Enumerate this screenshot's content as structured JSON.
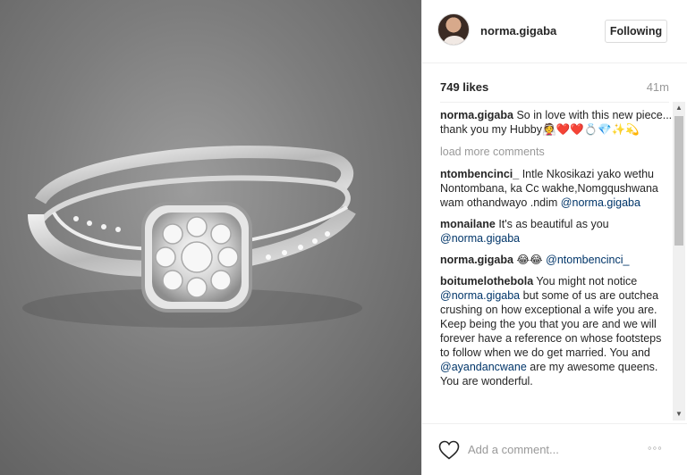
{
  "post": {
    "username": "norma.gigaba",
    "follow_label": "Following",
    "likes": "749 likes",
    "time": "41m",
    "add_comment_placeholder": "Add a comment...",
    "more_icon": "more-options-icon"
  },
  "caption": {
    "user": "norma.gigaba",
    "text": "So in love with this new piece... thank you my Hubby👰❤️❤️💍💎✨💫"
  },
  "load_more": "load more comments",
  "comments": [
    {
      "user": "ntombencinci_",
      "text": "Intle Nkosikazi yako wethu Nontombana, ka Cc wakhe,Nomgqushwana wam othandwayo .ndim ",
      "mention": "@norma.gigaba",
      "text_after": ""
    },
    {
      "user": "monailane",
      "text": "It's as beautiful as you ",
      "mention": "@norma.gigaba",
      "text_after": ""
    },
    {
      "user": "norma.gigaba",
      "text": "😂😂 ",
      "mention": "@ntombencinci_",
      "text_after": ""
    },
    {
      "user": "boitumelothebola",
      "text": "You might not notice ",
      "mention": "@norma.gigaba",
      "text_after": " but some of us are outchea crushing on how exceptional a wife you are. Keep being the you that you are and we will forever have a reference on whose footsteps to follow when we do get married. You and ",
      "mention2": "@ayandancwane",
      "text_after2": " are my awesome queens. You are wonderful."
    }
  ]
}
